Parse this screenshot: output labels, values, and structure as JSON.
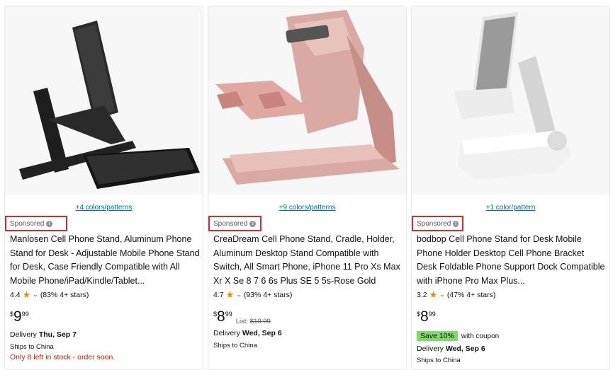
{
  "products": [
    {
      "colors": "+4 colors/patterns",
      "sponsored": "Sponsored",
      "title": "Manlosen Cell Phone Stand, Aluminum Phone Stand for Desk - Adjustable Mobile Phone Stand for Desk, Case Friendly Compatible with All Mobile Phone/iPad/Kindle/Tablet...",
      "rating": "4.4",
      "reviews": "(83% 4+ stars)",
      "price_symbol": "$",
      "price_whole": "9",
      "price_fraction": "99",
      "delivery_label": "Delivery",
      "delivery_date": "Thu, Sep 7",
      "ships": "Ships to China",
      "stock": "Only 8 left in stock - order soon."
    },
    {
      "colors": "+9 colors/patterns",
      "sponsored": "Sponsored",
      "title": "CreaDream Cell Phone Stand, Cradle, Holder, Aluminum Desktop Stand Compatible with Switch, All Smart Phone, iPhone 11 Pro Xs Max Xr X Se 8 7 6 6s Plus SE 5 5s-Rose Gold",
      "rating": "4.7",
      "reviews": "(93% 4+ stars)",
      "price_symbol": "$",
      "price_whole": "8",
      "price_fraction": "99",
      "list_label": "List:",
      "list_price": "$10.99",
      "delivery_label": "Delivery",
      "delivery_date": "Wed, Sep 6",
      "ships": "Ships to China"
    },
    {
      "colors": "+1 color/pattern",
      "sponsored": "Sponsored",
      "title": "bodbop Cell Phone Stand for Desk Mobile Phone Holder Desktop Cell Phone Bracket Desk Foldable Phone Support Dock Compatible with iPhone Pro Max Plus...",
      "rating": "3.2",
      "reviews": "(47% 4+ stars)",
      "price_symbol": "$",
      "price_whole": "8",
      "price_fraction": "99",
      "coupon_badge": "Save 10%",
      "coupon_text": "with coupon",
      "delivery_label": "Delivery",
      "delivery_date": "Wed, Sep 6",
      "ships": "Ships to China"
    }
  ],
  "icons": {
    "info": "info-icon",
    "star": "star-icon",
    "chevron": "chevron-down-icon"
  },
  "colors_theme": {
    "link": "#007185",
    "sponsored_box": "#c7322f",
    "stock": "#b12704",
    "coupon": "#7fda69",
    "star": "#f08804"
  }
}
